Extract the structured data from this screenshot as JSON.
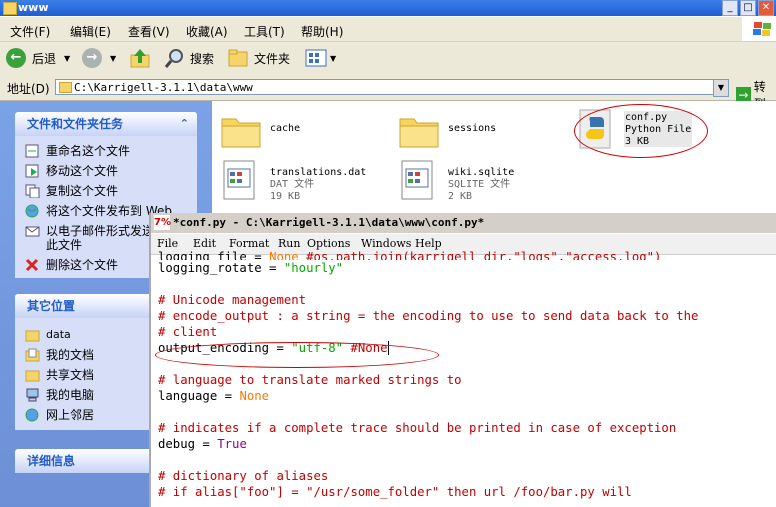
{
  "window": {
    "title": "www",
    "btn_min": "_",
    "btn_max": "□",
    "btn_close": "✕"
  },
  "menu": [
    "文件(F)",
    "编辑(E)",
    "查看(V)",
    "收藏(A)",
    "工具(T)",
    "帮助(H)"
  ],
  "toolbar": {
    "back": "后退",
    "search": "搜索",
    "folders": "文件夹"
  },
  "address": {
    "label": "地址(D)",
    "value": "C:\\Karrigell-3.1.1\\data\\www",
    "go": "转到"
  },
  "tasks": {
    "header": "文件和文件夹任务",
    "items": [
      "重命名这个文件",
      "移动这个文件",
      "复制这个文件",
      "将这个文件发布到 Web",
      "以电子邮件形式发送此文件",
      "删除这个文件"
    ]
  },
  "places": {
    "header": "其它位置",
    "items": [
      "data",
      "我的文档",
      "共享文档",
      "我的电脑",
      "网上邻居"
    ]
  },
  "details": {
    "header": "详细信息"
  },
  "files": [
    {
      "name": "cache"
    },
    {
      "name": "sessions"
    },
    {
      "name": "conf.py",
      "type": "Python File",
      "size": "3 KB"
    },
    {
      "name": "translations.dat",
      "type": "DAT 文件",
      "size": "19 KB"
    },
    {
      "name": "wiki.sqlite",
      "type": "SQLITE 文件",
      "size": "2 KB"
    }
  ],
  "editor": {
    "title": "*conf.py - C:\\Karrigell-3.1.1\\data\\www\\conf.py*",
    "icon_text": "7%",
    "menu": [
      "File",
      "Edit",
      "Format",
      "Run",
      "Options",
      "Windows",
      "Help"
    ]
  }
}
